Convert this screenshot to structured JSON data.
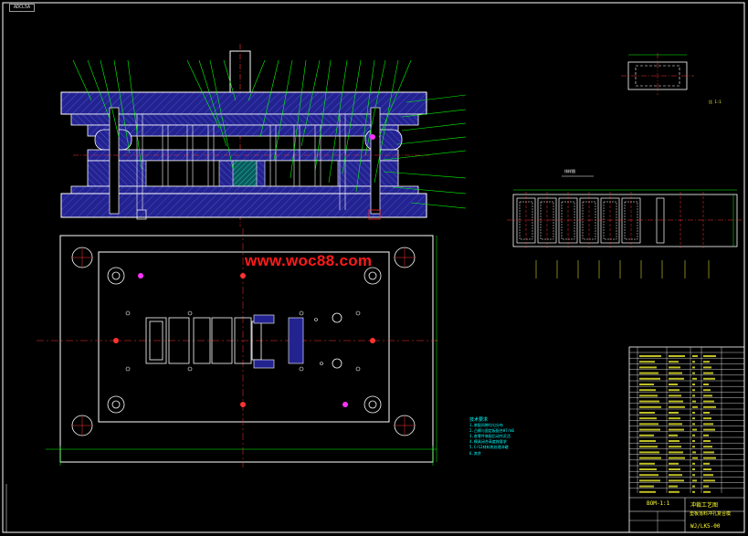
{
  "frame_tag": "ADCL5A",
  "watermark": "www.woc88.com",
  "title_block": {
    "title": "冲裁工艺图",
    "part_name": "垫板落料冲孔复合模",
    "drawing_code": "WJ/LK5-00",
    "scale": "BOM-1:1",
    "ratio_note": "比 1:1"
  },
  "notes": {
    "title": "技术要求",
    "items": [
      "1.装配间隙均匀分布",
      "2.凸模与固定板配合H7/m6",
      "3.各零件装配后动作灵活",
      "4.模具闭合高度按要求",
      "5.Cr12材料热处理淬硬",
      "6.其余"
    ]
  },
  "strip_layout": {
    "label": "排样图"
  },
  "colors": {
    "background": "#000000",
    "frame": "#ffffff",
    "plate_fill": "#232390",
    "hatch": "#3333aa",
    "leader": "#00ff00",
    "outline": "#ffffff",
    "center_line": "#ff3333",
    "text": "#ffff33",
    "note_text": "#00ffff",
    "magenta": "#ff33ff"
  }
}
